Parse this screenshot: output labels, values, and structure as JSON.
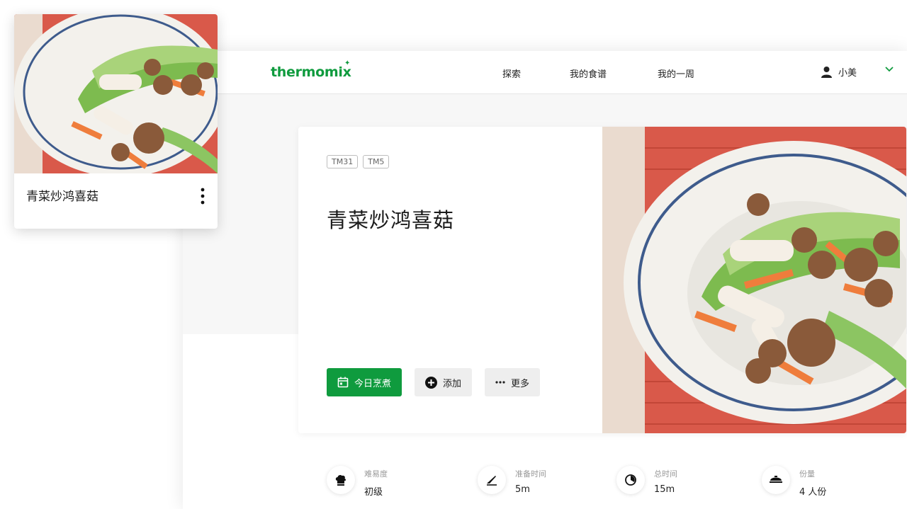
{
  "brand": {
    "logo": "thermomix",
    "accent": "#0f9b3e"
  },
  "nav": {
    "items": [
      "探索",
      "我的食谱",
      "我的一周"
    ],
    "user_name": "小美"
  },
  "recipe": {
    "tags": [
      "TM31",
      "TM5"
    ],
    "title": "青菜炒鸿喜菇",
    "actions": {
      "cook_today": "今日烹煮",
      "add": "添加",
      "more": "更多"
    },
    "meta": [
      {
        "icon": "chef-hat-icon",
        "label": "难易度",
        "value": "初级"
      },
      {
        "icon": "knife-icon",
        "label": "准备时间",
        "value": "5m"
      },
      {
        "icon": "timer-icon",
        "label": "总时间",
        "value": "15m"
      },
      {
        "icon": "servings-icon",
        "label": "份量",
        "value": "4 人份"
      }
    ]
  },
  "floating_card": {
    "title": "青菜炒鸿喜菇"
  }
}
